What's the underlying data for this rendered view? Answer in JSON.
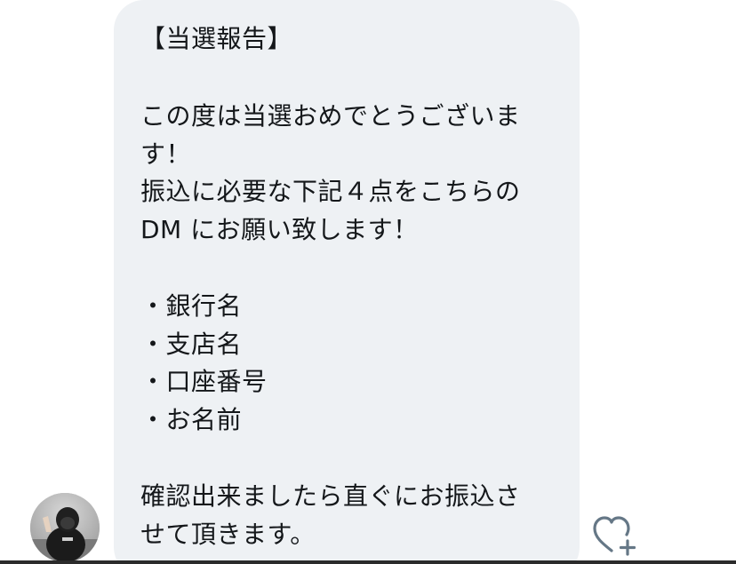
{
  "message": {
    "lines": [
      "【当選報告】",
      "",
      "この度は当選おめでとうございま",
      "す！",
      "振込に必要な下記４点をこちらの",
      "DM にお願い致します！",
      "",
      "・銀行名",
      "・支店名",
      "・口座番号",
      "・お名前",
      "",
      "確認出来ましたら直ぐにお振込さ",
      "せて頂きます。"
    ]
  },
  "icons": {
    "avatar": "avatar-photo",
    "like": "heart-plus-icon"
  },
  "colors": {
    "bubble": "#eef1f4",
    "text": "#14171a",
    "icon": "#657786"
  }
}
